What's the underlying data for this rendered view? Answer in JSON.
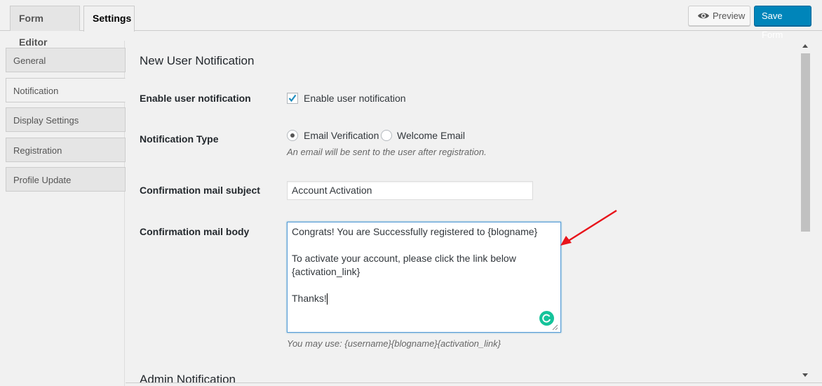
{
  "tabs": [
    {
      "label": "Form Editor",
      "active": false
    },
    {
      "label": "Settings",
      "active": true
    }
  ],
  "toolbar": {
    "preview_label": "Preview",
    "preview_icon": "eye-icon",
    "save_label": "Save Form"
  },
  "sidebar": {
    "items": [
      {
        "label": "General",
        "active": false
      },
      {
        "label": "Notification",
        "active": true
      },
      {
        "label": "Display Settings",
        "active": false
      },
      {
        "label": "Registration",
        "active": false
      },
      {
        "label": "Profile Update",
        "active": false
      }
    ]
  },
  "main": {
    "section_title": "New User Notification",
    "enable": {
      "label": "Enable user notification",
      "checkbox_label": "Enable user notification",
      "checked": true
    },
    "type": {
      "label": "Notification Type",
      "options": [
        {
          "label": "Email Verification",
          "selected": true
        },
        {
          "label": "Welcome Email",
          "selected": false
        }
      ],
      "help": "An email will be sent to the user after registration."
    },
    "subject": {
      "label": "Confirmation mail subject",
      "value": "Account Activation"
    },
    "body": {
      "label": "Confirmation mail body",
      "lines": [
        "Congrats! You are Successfully registered to {blogname}",
        "",
        "To activate your account, please click the link below",
        "{activation_link}",
        "",
        "Thanks!"
      ],
      "help": "You may use: {username}{blogname}{activation_link}"
    },
    "next_section_title": "Admin Notification"
  },
  "colors": {
    "accent": "#0085ba",
    "annotation_arrow": "#e8141b",
    "grammarly": "#15c39a"
  }
}
